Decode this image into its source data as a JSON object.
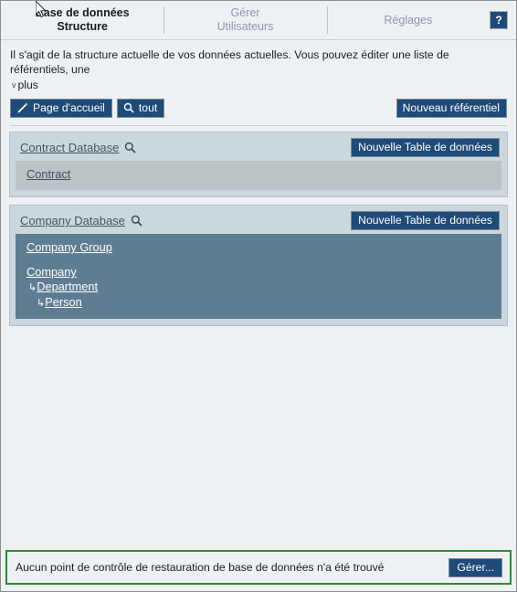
{
  "window": {
    "tabs": [
      {
        "line1": "Base de données",
        "line2": "Structure",
        "active": true
      },
      {
        "line1": "Gérer",
        "line2": "Utilisateurs",
        "active": false
      },
      {
        "line1": "Réglages",
        "line2": "",
        "active": false
      }
    ],
    "help_label": "?"
  },
  "intro": {
    "text": "Il s'agit de la structure actuelle de vos données actuelles. Vous pouvez éditer une liste de référentiels, une",
    "more_label": "plus",
    "more_chevron": "v"
  },
  "toolbar": {
    "home_label": "Page d'accueil",
    "home_icon": "pencil-icon",
    "search_label": "tout",
    "search_icon": "magnifier-icon",
    "new_repository_label": "Nouveau référentiel"
  },
  "databases": [
    {
      "name": "Contract Database",
      "search_icon": "magnifier-icon",
      "new_table_label": "Nouvelle Table de données",
      "style": "grey",
      "groups": [
        {
          "rows": [
            {
              "label": "Contract",
              "depth": 0
            }
          ]
        }
      ]
    },
    {
      "name": "Company Database",
      "search_icon": "magnifier-icon",
      "new_table_label": "Nouvelle Table de données",
      "style": "slate",
      "groups": [
        {
          "rows": [
            {
              "label": "Company Group",
              "depth": 0
            }
          ]
        },
        {
          "rows": [
            {
              "label": "Company",
              "depth": 0
            },
            {
              "label": "Department",
              "depth": 1,
              "elbow": "↳"
            },
            {
              "label": "Person",
              "depth": 2,
              "elbow": "↳"
            }
          ]
        }
      ]
    }
  ],
  "statusbar": {
    "message": "Aucun point de contrôle de restauration de base de données n'a été trouvé",
    "manage_label": "Gérer...",
    "border_color": "#2d8a2d"
  },
  "colors": {
    "accent_button": "#1f4b78",
    "panel_outer": "#ccd6dd",
    "panel_inner_grey": "#bcc3c6",
    "panel_inner_slate": "#5f7d92",
    "page_background": "#eef1f4",
    "status_green": "#2d8a2d"
  }
}
